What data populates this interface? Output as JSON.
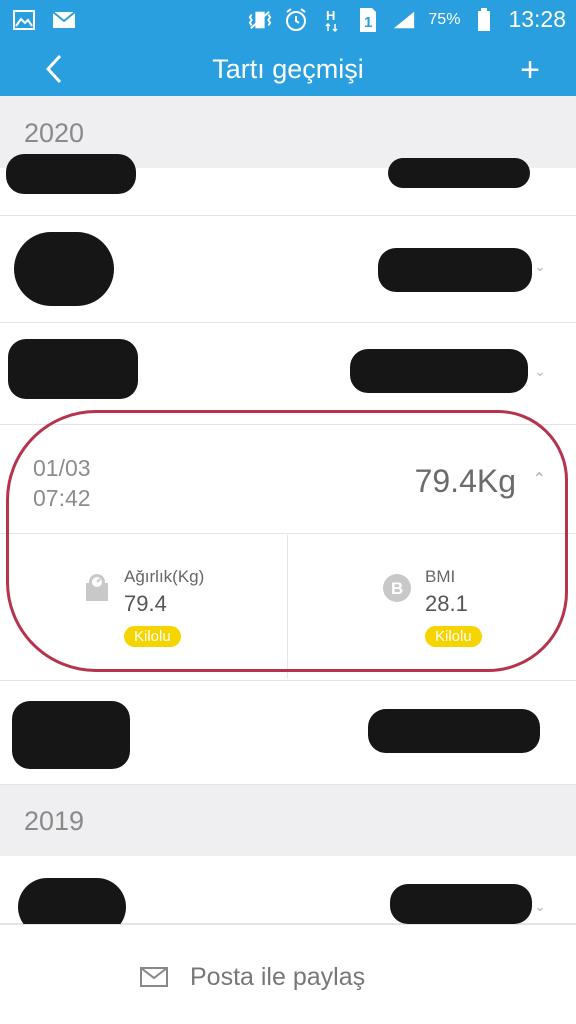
{
  "status_bar": {
    "battery": "75%",
    "time": "13:28",
    "icons": [
      "gallery-icon",
      "mail-icon",
      "vibrate-icon",
      "alarm-icon",
      "hplus-network-icon",
      "sim-1-icon",
      "signal-icon",
      "battery-icon"
    ]
  },
  "app_bar": {
    "title": "Tartı geçmişi",
    "add_label": "+",
    "background": "#2a9fe0"
  },
  "sections": [
    {
      "year": "2020"
    },
    {
      "year": "2019"
    }
  ],
  "expanded_entry": {
    "date": "01/03",
    "time": "07:42",
    "weight": "79.4Kg",
    "metrics": [
      {
        "label": "Ağırlık(Kg)",
        "value": "79.4",
        "badge": "Kilolu",
        "icon": "scale-icon"
      },
      {
        "label": "BMI",
        "value": "28.1",
        "badge": "Kilolu",
        "icon": "bmi-icon"
      }
    ],
    "badge_color": "#f5d400",
    "annotation_color": "#b5334d"
  },
  "bottom_bar": {
    "share_label": "Posta ile paylaş",
    "icon": "mail-icon"
  }
}
